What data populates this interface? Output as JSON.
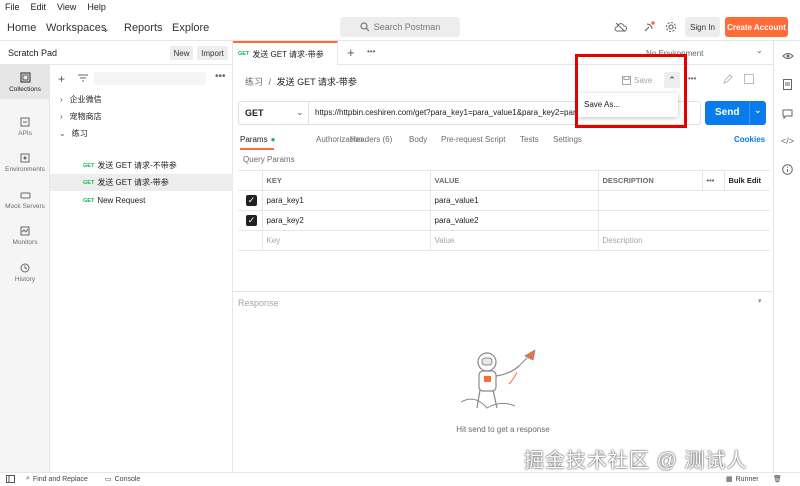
{
  "menubar": {
    "items": [
      "File",
      "Edit",
      "View",
      "Help"
    ]
  },
  "header": {
    "nav": [
      "Home",
      "Workspaces",
      "Reports",
      "Explore"
    ],
    "search_placeholder": "Search Postman",
    "signin": "Sign In",
    "create_account": "Create Account"
  },
  "sidebar": {
    "title": "Scratch Pad",
    "new_label": "New",
    "import_label": "Import",
    "rail": [
      {
        "label": "Collections",
        "icon": "collections-icon"
      },
      {
        "label": "APIs",
        "icon": "apis-icon"
      },
      {
        "label": "Environments",
        "icon": "environments-icon"
      },
      {
        "label": "Mock Servers",
        "icon": "mock-servers-icon"
      },
      {
        "label": "Monitors",
        "icon": "monitors-icon"
      },
      {
        "label": "History",
        "icon": "history-icon"
      }
    ],
    "tree": [
      {
        "label": "企业微信",
        "type": "folder"
      },
      {
        "label": "宠物商店",
        "type": "folder"
      },
      {
        "label": "练习",
        "type": "folder-open"
      },
      {
        "method": "GET",
        "label": "发送 GET 请求-不带参"
      },
      {
        "method": "GET",
        "label": "发送 GET 请求-带参"
      },
      {
        "method": "GET",
        "label": "New Request"
      }
    ]
  },
  "tab": {
    "method": "GET",
    "title": "发送 GET 请求-带参"
  },
  "env": {
    "label": "No Environment"
  },
  "breadcrumb": {
    "parent": "练习",
    "separator": "/",
    "current": "发送 GET 请求-带参"
  },
  "save": {
    "label": "Save",
    "menu_item": "Save As..."
  },
  "request": {
    "method": "GET",
    "url": "https://httpbin.ceshiren.com/get?para_key1=para_value1&para_key2=para_value2",
    "send_label": "Send",
    "tabs": [
      "Params",
      "Authorization",
      "Headers (6)",
      "Body",
      "Pre-request Script",
      "Tests",
      "Settings"
    ],
    "cookies_label": "Cookies",
    "query_params_label": "Query Params",
    "columns": [
      "KEY",
      "VALUE",
      "DESCRIPTION"
    ],
    "bulk_edit": "Bulk Edit",
    "rows": [
      {
        "key": "para_key1",
        "value": "para_value1",
        "description": ""
      },
      {
        "key": "para_key2",
        "value": "para_value2",
        "description": ""
      }
    ],
    "placeholders": {
      "key": "Key",
      "value": "Value",
      "description": "Description"
    }
  },
  "response": {
    "label": "Response",
    "hint": "Hit send to get a response"
  },
  "footer": {
    "find_replace": "Find and Replace",
    "console": "Console",
    "runner": "Runner"
  },
  "watermark": "掘金技术社区 @ 测试人",
  "colors": {
    "accent": "#ff6c37",
    "send": "#097bed",
    "get": "#0cbb52",
    "highlight_box": "#e60000"
  }
}
